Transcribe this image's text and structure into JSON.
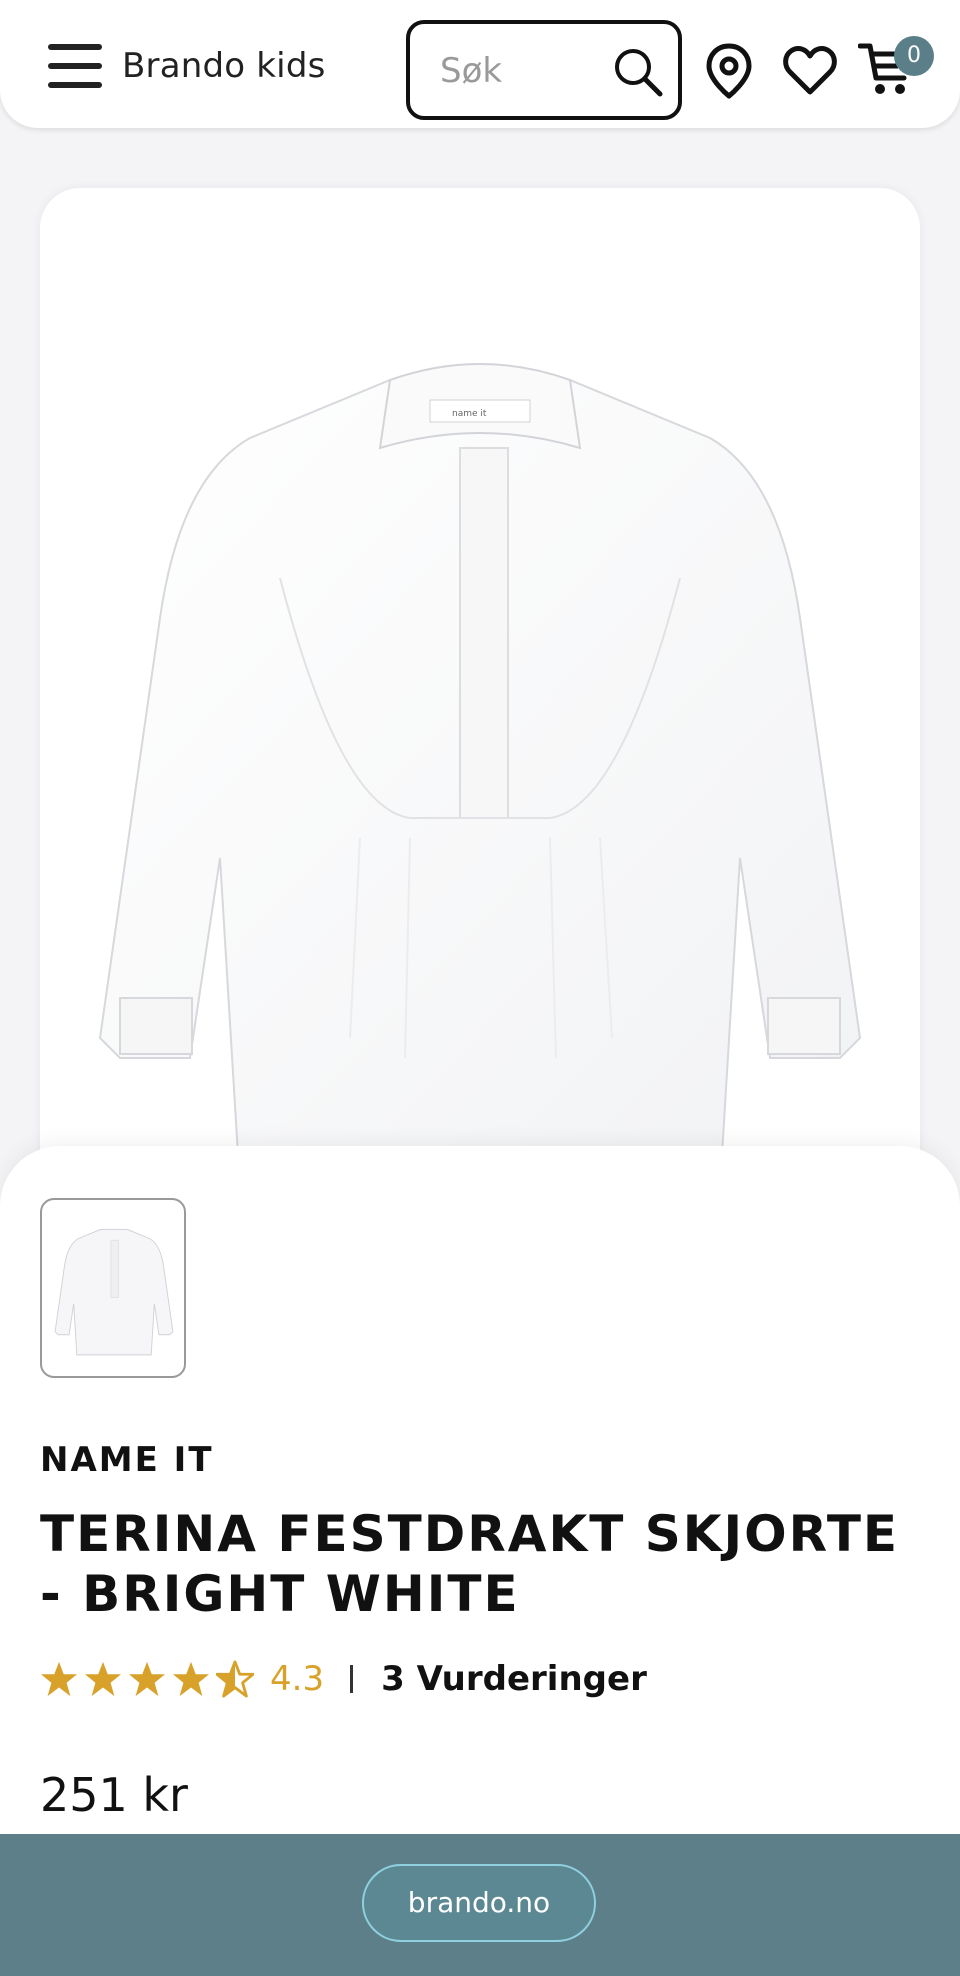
{
  "header": {
    "brand": "Brando kids",
    "search_placeholder": "Søk",
    "cart_count": "0",
    "icons": [
      "menu-icon",
      "search-icon",
      "location-pin-icon",
      "heart-icon",
      "cart-icon"
    ]
  },
  "product": {
    "brand": "NAME IT",
    "title": "TERINA FESTDRAKT SKJORTE - BRIGHT WHITE",
    "rating_value": "4.3",
    "rating_stars": 4.3,
    "reviews": "3 Vurderinger",
    "price": "251 kr",
    "label_text": "name it"
  },
  "footer": {
    "domain": "brando.no"
  },
  "colors": {
    "accent_star": "#d8a22a",
    "bar": "#5d7f89",
    "badge": "#5b7f89"
  }
}
